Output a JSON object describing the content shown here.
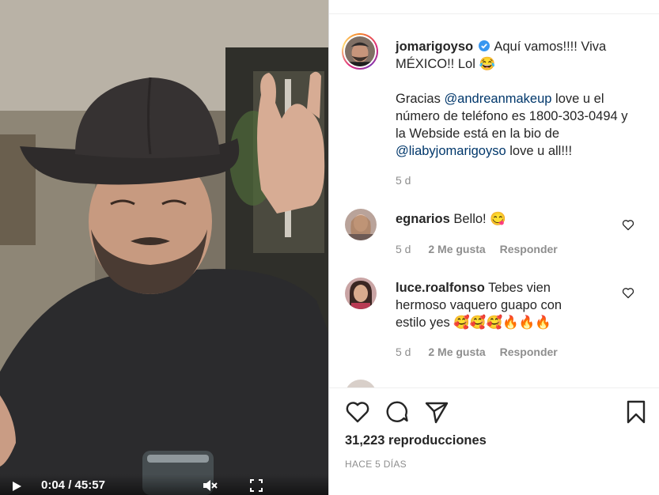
{
  "video": {
    "current_time": "0:04",
    "separator": " / ",
    "duration": "45:57",
    "play_icon": "play-icon",
    "mute_icon": "muted-speaker-icon",
    "fullscreen_icon": "fullscreen-icon"
  },
  "post": {
    "author": "jomarigoyso",
    "verified": true,
    "caption_line1": " Aquí vamos!!!! Viva MÉXICO!! Lol 😂",
    "caption_p2_before": "Gracias ",
    "mention1": "@andreanmakeup",
    "caption_p2_middle": " love u el número de teléfono es 1800-303-0494 y la Webside está en la bio de ",
    "mention2": "@liabyjomarigoyso",
    "caption_p2_after": " love u all!!!",
    "time": "5 d"
  },
  "comments": [
    {
      "username": "egnarios",
      "text": " Bello! 😋",
      "time": "5 d",
      "likes": "2 Me gusta",
      "reply": "Responder"
    },
    {
      "username": "luce.roalfonso",
      "text": " Tebes vien hermoso vaquero guapo con estilo yes 🥰🥰🥰🔥🔥🔥",
      "time": "5 d",
      "likes": "2 Me gusta",
      "reply": "Responder"
    }
  ],
  "actions": {
    "like_icon": "heart-icon",
    "comment_icon": "comment-icon",
    "share_icon": "paper-plane-icon",
    "save_icon": "bookmark-icon"
  },
  "stats": {
    "views": "31,223 reproducciones",
    "posted": "HACE 5 DÍAS"
  },
  "colors": {
    "mention": "#00376b",
    "secondary_text": "#8e8e8e",
    "verified": "#3897f0"
  }
}
